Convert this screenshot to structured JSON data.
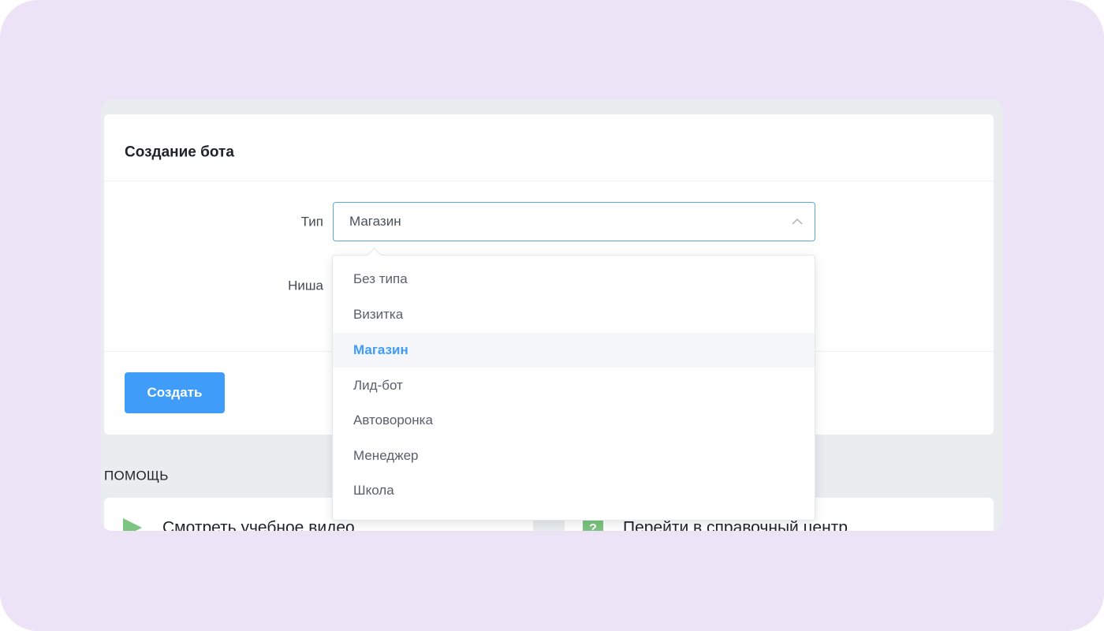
{
  "form": {
    "title": "Создание бота",
    "type_label": "Тип",
    "niche_label": "Ниша",
    "type_value": "Магазин",
    "create_button": "Создать"
  },
  "dropdown": {
    "options": [
      "Без типа",
      "Визитка",
      "Магазин",
      "Лид-бот",
      "Автоворонка",
      "Менеджер",
      "Школа"
    ],
    "selected": "Магазин"
  },
  "help": {
    "title": "ПОМОЩЬ",
    "video_link": "Смотреть учебное видео",
    "help_center_link": "Перейти в справочный центр"
  },
  "colors": {
    "backdrop": "#ece3f7",
    "accent": "#3f9cf8",
    "icon_green": "#7cc47f"
  },
  "icons": {
    "chevron": "chevron-up-icon",
    "video": "play-icon",
    "help": "question-icon"
  }
}
